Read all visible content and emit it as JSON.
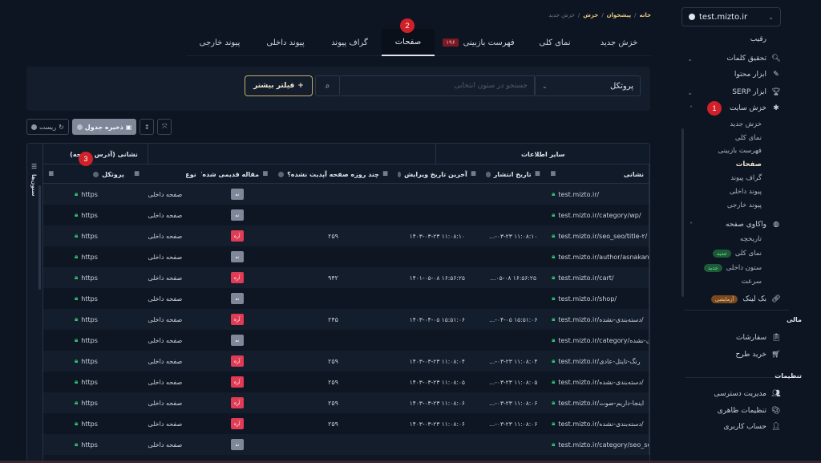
{
  "sidebar": {
    "site": "test.mizto.ir",
    "items": [
      {
        "label": "رقیب",
        "icon": "none"
      },
      {
        "label": "تحقیق کلمات",
        "icon": "search-icon",
        "caret": "down"
      },
      {
        "label": "ابزار محتوا",
        "icon": "pencil-icon"
      },
      {
        "label": "ابزار SERP",
        "icon": "trophy-icon",
        "caret": "down"
      },
      {
        "label": "خزش سایت",
        "icon": "bug-icon",
        "caret": "up"
      }
    ],
    "crawl_sub": [
      "خزش جدید",
      "نمای کلی",
      "فهرست بازبینی",
      "صفحات",
      "گراف پیوند",
      "پیوند داخلی",
      "پیوند خارجی"
    ],
    "crawl_active": "صفحات",
    "page_analysis": {
      "label": "واکاوی صفحه",
      "icon": "globe-icon"
    },
    "page_analysis_sub": [
      {
        "label": "تاریخچه"
      },
      {
        "label": "نمای کلی",
        "badge": "جدید"
      },
      {
        "label": "ستون داخلی",
        "badge": "جدید"
      },
      {
        "label": "سرعت"
      }
    ],
    "backlink": {
      "label": "بک لینک",
      "badge": "آزمایشی"
    },
    "finance_title": "مالی",
    "finance": [
      {
        "label": "سفارشات",
        "icon": "clipboard-icon"
      },
      {
        "label": "خرید طرح",
        "icon": "cart-icon"
      }
    ],
    "settings_title": "تنظیمات",
    "settings": [
      {
        "label": "مدیریت دسترسی",
        "icon": "users-icon"
      },
      {
        "label": "تنظیمات ظاهری",
        "icon": "palette-icon"
      },
      {
        "label": "حساب کاربری",
        "icon": "user-icon"
      }
    ]
  },
  "markers": [
    "1",
    "2",
    "3"
  ],
  "breadcrumb": [
    "خانه",
    "پیشخوان",
    "خزش",
    "خزش جدید"
  ],
  "tabs": [
    {
      "label": "خزش جدید"
    },
    {
      "label": "نمای کلی"
    },
    {
      "label": "فهرست بازبینی",
      "badge": "۱۹۶"
    },
    {
      "label": "صفحات",
      "active": true
    },
    {
      "label": "گراف پیوند"
    },
    {
      "label": "پیوند داخلی"
    },
    {
      "label": "پیوند خارجی"
    }
  ],
  "filter": {
    "column_select": "پروتکل",
    "search_placeholder": "جستجو در ستون انتخابی",
    "more_filter": "فیلتر بیشتر"
  },
  "toolbar": {
    "save_label": "ذخیره جدول",
    "reset_label": "ریست"
  },
  "table": {
    "columns_tab": "ستون‌ها",
    "groups": [
      "نشانی (آدرس صفحه)",
      "سایر اطلاعات"
    ],
    "headers": [
      "نشانی",
      "تاریخ انتشار",
      "آخرین تاریخ ویرایش",
      "چند روزه صفحه آپدیت نشده؟",
      "مقاله قدیمی شده؟",
      "نوع",
      "پروتکل"
    ],
    "rows": [
      {
        "address": "test.mizto.ir/",
        "published": "",
        "edited": "",
        "days": "",
        "old": "نه",
        "old_flag": "no",
        "type": "صفحه داخلی",
        "protocol": "https"
      },
      {
        "address": "test.mizto.ir/category/wp/",
        "published": "",
        "edited": "",
        "days": "",
        "old": "نه",
        "old_flag": "no",
        "type": "صفحه داخلی",
        "protocol": "https"
      },
      {
        "address": "test.mizto.ir/seo_seo/title-۲/",
        "published": "...-۰۳-۲۳ ۱۱:۰۸:۱۰",
        "edited": "۱۴۰۳-۰۳-۲۳ ۱۱:۰۸:۱۰",
        "days": "۲۵۹",
        "old": "آره",
        "old_flag": "yes",
        "type": "صفحه داخلی",
        "protocol": "https"
      },
      {
        "address": "test.mizto.ir/author/asnakanl",
        "published": "",
        "edited": "",
        "days": "",
        "old": "نه",
        "old_flag": "no",
        "type": "صفحه داخلی",
        "protocol": "https"
      },
      {
        "address": "test.mizto.ir/cart/",
        "published": "...۰۵-۰۸ ۱۶:۵۶:۲۵",
        "edited": "۱۴۰۱-۰۵-۰۸ ۱۶:۵۶:۲۵",
        "days": "۹۴۲",
        "old": "آره",
        "old_flag": "yes",
        "type": "صفحه داخلی",
        "protocol": "https"
      },
      {
        "address": "test.mizto.ir/shop/",
        "published": "",
        "edited": "",
        "days": "",
        "old": "نه",
        "old_flag": "no",
        "type": "صفحه داخلی",
        "protocol": "https"
      },
      {
        "address": "test.mizto.ir/دسته‌بندی-نشده/",
        "published": "...-۰۴-۰۵ ۱۵:۵۱:۰۶",
        "edited": "۱۴۰۳-۰۴-۰۵ ۱۵:۵۱:۰۶",
        "days": "۲۴۵",
        "old": "آره",
        "old_flag": "yes",
        "type": "صفحه داخلی",
        "protocol": "https"
      },
      {
        "address": "test.mizto.ir/category/دسته‌بندی-نشده",
        "published": "",
        "edited": "",
        "days": "",
        "old": "نه",
        "old_flag": "no",
        "type": "صفحه داخلی",
        "protocol": "https"
      },
      {
        "address": "test.mizto.ir/رنگ-تایتل-عادی",
        "published": "...-۰۳-۲۳ ۱۱:۰۸:۰۴",
        "edited": "۱۴۰۳-۰۳-۲۳ ۱۱:۰۸:۰۴",
        "days": "۲۵۹",
        "old": "آره",
        "old_flag": "yes",
        "type": "صفحه داخلی",
        "protocol": "https"
      },
      {
        "address": "test.mizto.ir/دسته‌بندی-نشده/",
        "published": "...-۰۳-۲۳ ۱۱:۰۸:۰۵",
        "edited": "۱۴۰۳-۰۳-۲۳ ۱۱:۰۸:۰۵",
        "days": "۲۵۹",
        "old": "آره",
        "old_flag": "yes",
        "type": "صفحه داخلی",
        "protocol": "https"
      },
      {
        "address": "test.mizto.ir/اینجا-داریم-صوت",
        "published": "...-۰۳-۲۳ ۱۱:۰۸:۰۶",
        "edited": "۱۴۰۳-۰۳-۲۳ ۱۱:۰۸:۰۶",
        "days": "۲۵۹",
        "old": "آره",
        "old_flag": "yes",
        "type": "صفحه داخلی",
        "protocol": "https"
      },
      {
        "address": "test.mizto.ir/دسته‌بندی-نشده/",
        "published": "...-۰۳-۲۳ ۱۱:۰۸:۰۶",
        "edited": "۱۴۰۳-۰۳-۲۳ ۱۱:۰۸:۰۶",
        "days": "۲۵۹",
        "old": "آره",
        "old_flag": "yes",
        "type": "صفحه داخلی",
        "protocol": "https"
      },
      {
        "address": "test.mizto.ir/category/seo_se",
        "published": "",
        "edited": "",
        "days": "",
        "old": "نه",
        "old_flag": "no",
        "type": "صفحه داخلی",
        "protocol": "https"
      }
    ]
  },
  "colors": {
    "background": "#0d1523",
    "accent_gold": "#c7ab6a",
    "yes_badge": "#e23b55",
    "no_badge": "#7e8899",
    "lock_green": "#2ecc71",
    "marker_red": "#d0202a"
  }
}
